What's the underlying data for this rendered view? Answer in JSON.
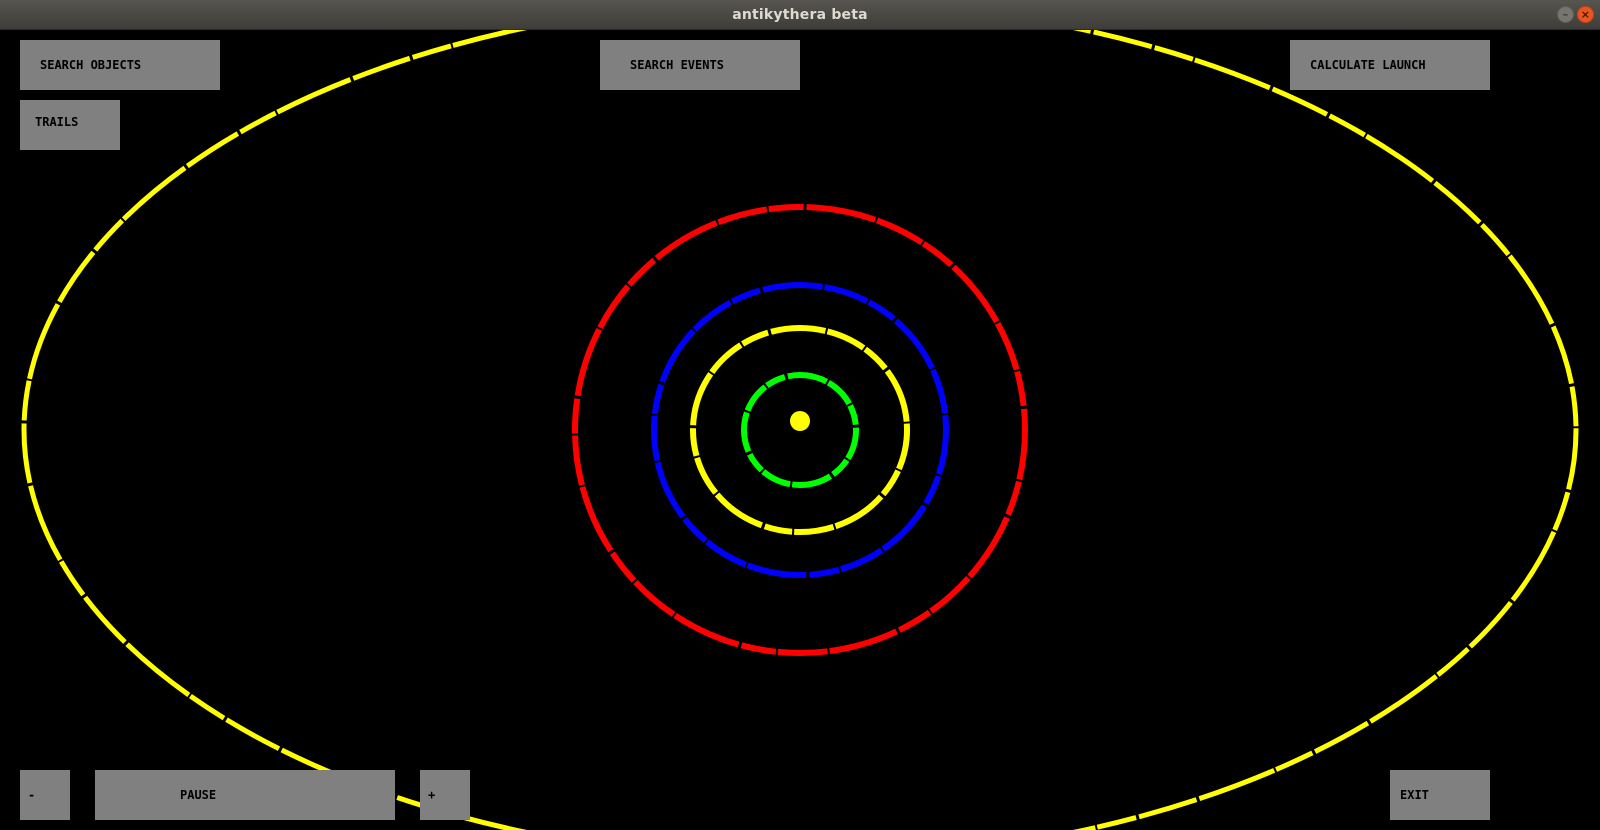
{
  "window": {
    "title": "antikythera beta"
  },
  "titlebar_controls": {
    "minimize_glyph": "–",
    "close_glyph": "×"
  },
  "buttons": {
    "search_objects": "SEARCH OBJECTS",
    "search_events": "SEARCH EVENTS",
    "calculate_launch": "CALCULATE LAUNCH",
    "trails": "TRAILS",
    "zoom_out": "-",
    "pause": "PAUSE",
    "zoom_in": "+",
    "exit": "EXIT"
  },
  "colors": {
    "background": "#000000",
    "button": "#808080",
    "sun": "#ffff00",
    "orbit_mercury": "#00ff00",
    "orbit_venus": "#ffff00",
    "orbit_earth": "#0000ff",
    "orbit_mars": "#ff0000",
    "orbit_jupiter": "#ffff00"
  }
}
